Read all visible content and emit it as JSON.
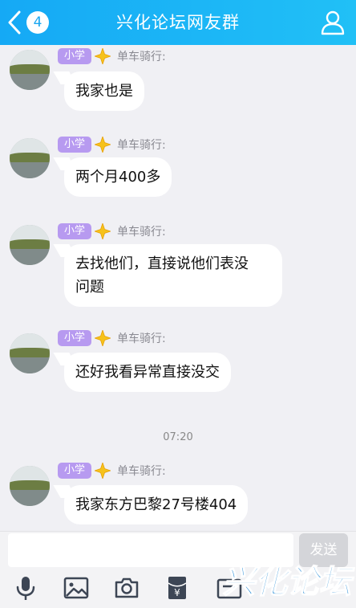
{
  "header": {
    "title": "兴化论坛网友群",
    "badge": "4"
  },
  "messages": [
    {
      "tag": "小学",
      "nickname": "单车骑行:",
      "text": "我家也是"
    },
    {
      "tag": "小学",
      "nickname": "单车骑行:",
      "text": "两个月400多"
    },
    {
      "tag": "小学",
      "nickname": "单车骑行:",
      "text_line1": "去找他们，直接说他们表没",
      "text_line2": "问题"
    },
    {
      "tag": "小学",
      "nickname": "单车骑行:",
      "text": "还好我看异常直接没交"
    },
    {
      "tag": "小学",
      "nickname": "单车骑行:",
      "text": "我家东方巴黎27号楼404"
    }
  ],
  "timestamp": "07:20",
  "input": {
    "placeholder": "",
    "value": "",
    "send_label": "发送"
  },
  "toolbar": {
    "icons": [
      "microphone-icon",
      "image-icon",
      "camera-icon",
      "red-packet-icon",
      "more-icon"
    ]
  },
  "watermark": {
    "text": "兴化论坛"
  },
  "colors": {
    "header": "#1ab2f5",
    "tag": "#b79af0",
    "background": "#f0f0f4",
    "star": "#f6c21b"
  }
}
